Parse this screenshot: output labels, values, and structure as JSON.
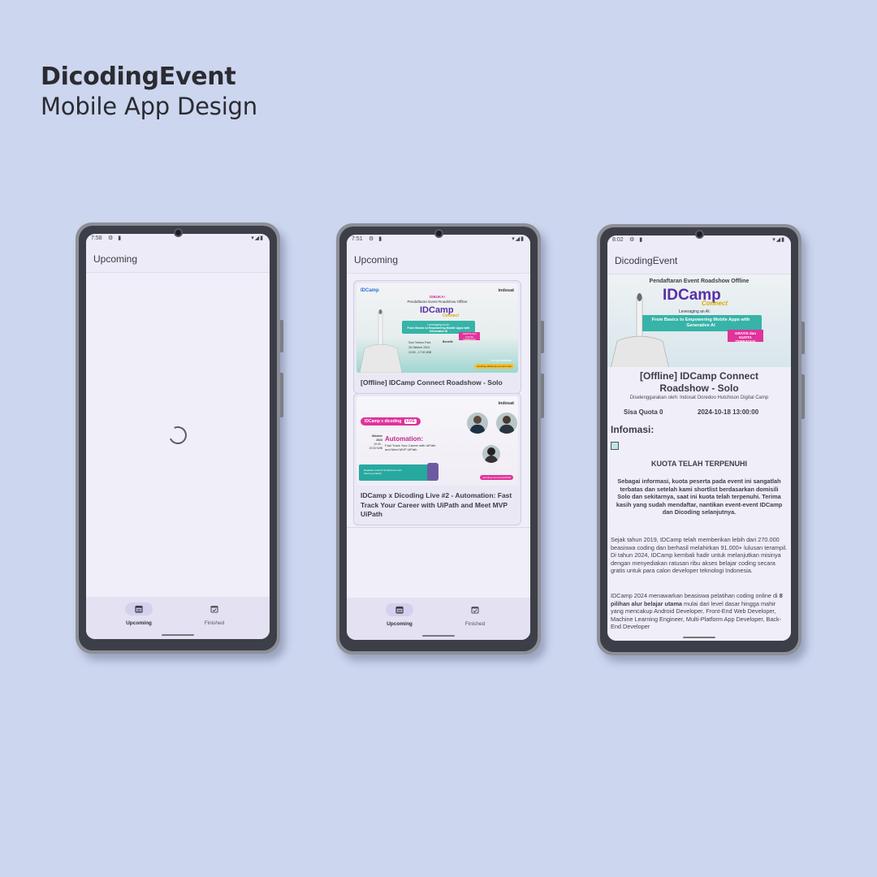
{
  "header": {
    "app_name": "DicodingEvent",
    "subtitle": "Mobile App Design"
  },
  "nav": {
    "upcoming": "Upcoming",
    "finished": "Finished"
  },
  "phone1": {
    "time": "7:58",
    "title": "Upcoming"
  },
  "phone2": {
    "time": "7:51",
    "title": "Upcoming",
    "cards": [
      {
        "title": "[Offline] IDCamp Connect  Roadshow - Solo",
        "poster": {
          "brand_left": "IDCamp",
          "brand_right": "indosat",
          "dibuka": "DIBUKA!",
          "headline": "Pendaftaran Event Roadshow Offline",
          "logo": "IDCamp",
          "logo_sub": "Connect",
          "banner_small": "Leveraging an AI:",
          "banner": "From Basics to Empowering Mobile Apps with Generative AI",
          "tag": "GRATIS dan KUOTA TERBATAS!",
          "venue": "Solo Techno Park",
          "date": "18 Oktober 2024",
          "hours": "13:00 - 17:00 WIB",
          "benefit_title": "Benefit:",
          "reg": "Link pendaftaran",
          "url": "dicoding.id/idcamp-connect-solo"
        }
      },
      {
        "title": "IDCamp x Dicoding Live #2 - Automation: Fast Track Your Career with UiPath and Meet MVP UiPath",
        "poster": {
          "brand_right": "indosat",
          "badge": "IDCamp x dicoding",
          "badge_live": "LIVE",
          "date": "Oktober 2024",
          "hours": "19:00 - 20:30 WIB",
          "headline": "Automation:",
          "sub": "Fast Track Your Career with UiPath and Meet MVP UiPath",
          "promo": "Dapatkan sebuah Smartphone dan Samsung Watch",
          "url": "dicoding.com/events/DND"
        }
      }
    ]
  },
  "phone3": {
    "time": "8:02",
    "title": "DicodingEvent",
    "poster": {
      "headline": "Pendaftaran Event Roadshow Offline",
      "logo": "IDCamp",
      "logo_sub": "Connect",
      "banner_small": "Leveraging an AI:",
      "banner": "From Basics to Empowering Mobile Apps with Generative AI",
      "tag": "GRATIS dan KUOTA TERBATAS!"
    },
    "event_title": "[Offline] IDCamp Connect Roadshow - Solo",
    "organizer": "Diselenggarakan oleh: Indosat Ooredoo Hutchison Digital Camp",
    "quota": "Sisa Quota 0",
    "datetime": "2024-10-18 13:00:00",
    "info_label": "Infomasi:",
    "full_heading": "KUOTA TELAH TERPENUHI",
    "bold_paragraph": "Sebagai informasi, kuota peserta pada event ini sangatlah terbatas dan setelah kami shortlist berdasarkan domisili Solo dan sekitarnya, saat ini kuota telah terpenuhi. Terima kasih yang sudah mendaftar, nantikan event-event IDCamp dan Dicoding selanjutnya.",
    "para1": "Sejak tahun 2019, IDCamp telah memberikan lebih dari 270.000 beasiswa coding dan berhasil melahirkan 91.000+ lulusan terampil. Di tahun 2024, IDCamp kembali hadir untuk melanjutkan misinya dengan  menyediakan ratusan ribu akses belajar coding secara gratis untuk para calon developer teknologi Indonesia.",
    "para2_a": "IDCamp 2024 menawarkan beasiswa pelatihan coding online di ",
    "para2_b": "8 pilihan alur belajar utama",
    "para2_c": " mulai dari level dasar hingga mahir yang mencakup Android Developer, Front-End Web Developer, Machine Learning Engineer, Multi-Platform App Developer, Back-End Developer"
  }
}
